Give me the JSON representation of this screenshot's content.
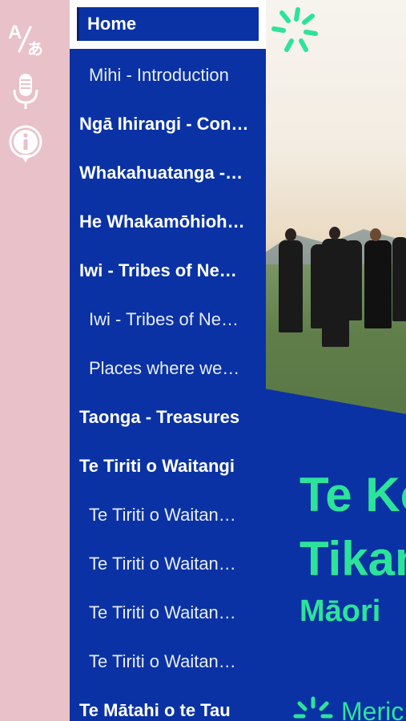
{
  "toolbar": {
    "buttons": [
      {
        "icon": "translate-icon"
      },
      {
        "icon": "microphone-icon"
      },
      {
        "icon": "info-icon"
      }
    ],
    "translate_glyph_latin": "A",
    "translate_glyph_jp": "あ"
  },
  "menu": {
    "home_label": "Home",
    "items": [
      {
        "label": "Mihi - Introduction",
        "level": "sub"
      },
      {
        "label": "Ngā Ihirangi - Con…",
        "level": "top"
      },
      {
        "label": "Whakahuatanga -…",
        "level": "top"
      },
      {
        "label": "He Whakamōhioh…",
        "level": "top"
      },
      {
        "label": "Iwi - Tribes of Ne…",
        "level": "top"
      },
      {
        "label": "Iwi - Tribes of Ne…",
        "level": "sub"
      },
      {
        "label": "Places where we…",
        "level": "sub"
      },
      {
        "label": "Taonga - Treasures",
        "level": "top"
      },
      {
        "label": "Te Tiriti o Waitangi",
        "level": "top"
      },
      {
        "label": "Te Tiriti o Waitan…",
        "level": "sub"
      },
      {
        "label": "Te Tiriti o Waitan…",
        "level": "sub"
      },
      {
        "label": "Te Tiriti o Waitan…",
        "level": "sub"
      },
      {
        "label": "Te Tiriti o Waitan…",
        "level": "sub"
      },
      {
        "label": "Te Mātahi o te Tau",
        "level": "top"
      }
    ]
  },
  "hero": {
    "line1": "Te Ko",
    "line2": "Tikan",
    "subtitle": "Māori",
    "brand": "Meric"
  },
  "colors": {
    "brand_blue": "#0a32a4",
    "accent_green": "#2de39a",
    "toolbar_pink": "#e9c1c8"
  }
}
